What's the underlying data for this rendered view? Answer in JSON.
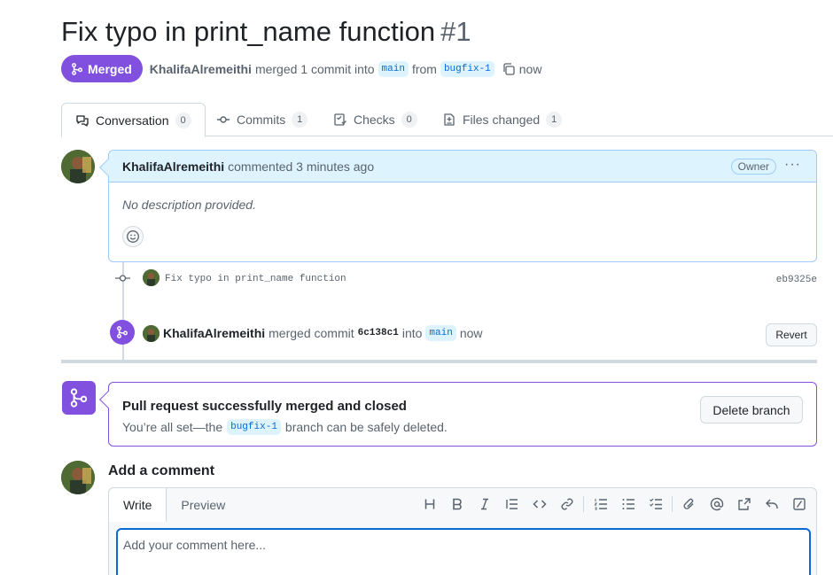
{
  "pr": {
    "title": "Fix typo in print_name function",
    "number": "#1",
    "status": "Merged",
    "author": "KhalifaAlremeithi",
    "merge_text": "merged 1 commit into",
    "base_branch": "main",
    "from_text": "from",
    "head_branch": "bugfix-1",
    "time": "now"
  },
  "tabs": [
    {
      "label": "Conversation",
      "count": "0"
    },
    {
      "label": "Commits",
      "count": "1"
    },
    {
      "label": "Checks",
      "count": "0"
    },
    {
      "label": "Files changed",
      "count": "1"
    }
  ],
  "comment": {
    "author": "KhalifaAlremeithi",
    "action": "commented 3 minutes ago",
    "badge": "Owner",
    "menu": "···",
    "body": "No description provided."
  },
  "commit": {
    "message": "Fix typo in print_name function",
    "sha": "eb9325e"
  },
  "merge_event": {
    "author": "KhalifaAlremeithi",
    "text": "merged commit",
    "sha": "6c138c1",
    "into": "into",
    "branch": "main",
    "time": "now",
    "revert_label": "Revert"
  },
  "merged_box": {
    "title": "Pull request successfully merged and closed",
    "sub_prefix": "You’re all set—the",
    "branch": "bugfix-1",
    "sub_suffix": "branch can be safely deleted.",
    "delete_label": "Delete branch"
  },
  "add_comment": {
    "title": "Add a comment",
    "write_tab": "Write",
    "preview_tab": "Preview",
    "placeholder": "Add your comment here...",
    "toolbar_icons": [
      "heading-icon",
      "bold-icon",
      "italic-icon",
      "quote-icon",
      "code-icon",
      "link-icon",
      "numbered-list-icon",
      "bullet-list-icon",
      "task-list-icon",
      "attach-icon",
      "mention-icon",
      "reference-icon",
      "reply-icon",
      "slash-command-icon"
    ]
  },
  "colors": {
    "merged_purple": "#8250df",
    "link_blue": "#0969da",
    "comment_header_bg": "#ddf4ff"
  }
}
